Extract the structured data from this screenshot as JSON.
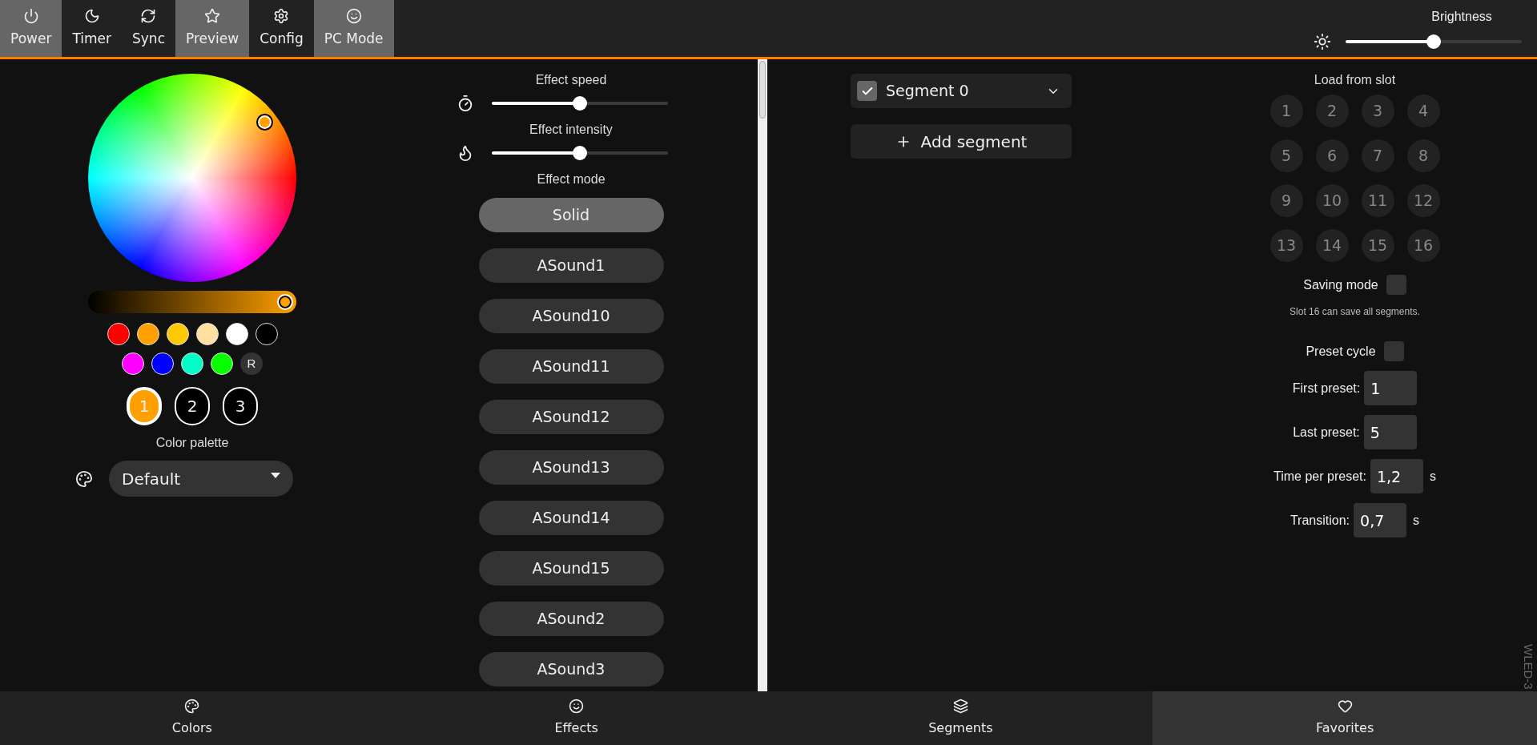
{
  "top_bar": {
    "buttons": [
      {
        "label": "Power",
        "selected": true
      },
      {
        "label": "Timer",
        "selected": false
      },
      {
        "label": "Sync",
        "selected": false
      },
      {
        "label": "Preview",
        "selected": true
      },
      {
        "label": "Config",
        "selected": false
      },
      {
        "label": "PC Mode",
        "selected": true
      }
    ],
    "brightness": {
      "label": "Brightness",
      "level": 0.5
    }
  },
  "colors": {
    "value_slider": {
      "level": 1
    },
    "quick_colors": [
      {
        "color": "#ff0000"
      },
      {
        "color": "#ffa000"
      },
      {
        "color": "#ffc800"
      },
      {
        "color": "#ffe0a0"
      },
      {
        "color": "#ffffff"
      },
      {
        "color": "#000000"
      },
      {
        "color": "#ff00ff"
      },
      {
        "color": "#0000ff"
      },
      {
        "color": "#00ffc8"
      },
      {
        "color": "#08ff00"
      }
    ],
    "random_button": "R",
    "slots": [
      {
        "label": "1",
        "selected": true
      },
      {
        "label": "2",
        "selected": false
      },
      {
        "label": "3",
        "selected": false
      }
    ],
    "palette_label": "Color palette",
    "palette": {
      "value": "Default"
    }
  },
  "effects": {
    "speed": {
      "label": "Effect speed",
      "level": 0.5
    },
    "intensity": {
      "label": "Effect intensity",
      "level": 0.5
    },
    "mode_label": "Effect mode",
    "modes": [
      {
        "label": "Solid",
        "selected": true
      },
      {
        "label": "ASound1",
        "selected": false
      },
      {
        "label": "ASound10",
        "selected": false
      },
      {
        "label": "ASound11",
        "selected": false
      },
      {
        "label": "ASound12",
        "selected": false
      },
      {
        "label": "ASound13",
        "selected": false
      },
      {
        "label": "ASound14",
        "selected": false
      },
      {
        "label": "ASound15",
        "selected": false
      },
      {
        "label": "ASound2",
        "selected": false
      },
      {
        "label": "ASound3",
        "selected": false
      }
    ]
  },
  "segments": {
    "items": [
      {
        "name": "Segment 0",
        "checked": true
      }
    ],
    "add_button": "Add segment"
  },
  "favorites": {
    "load_label": "Load from slot",
    "slots": [
      "1",
      "2",
      "3",
      "4",
      "5",
      "6",
      "7",
      "8",
      "9",
      "10",
      "11",
      "12",
      "13",
      "14",
      "15",
      "16"
    ],
    "saving_mode": {
      "label": "Saving mode",
      "checked": false
    },
    "note": "Slot 16 can save all segments.",
    "preset_cycle": {
      "label": "Preset cycle",
      "checked": false
    },
    "fields": [
      {
        "label": "First preset:",
        "value": "1"
      },
      {
        "label": "Last preset:",
        "value": "5"
      },
      {
        "label": "Time per preset:",
        "value": "1,2",
        "unit": "s"
      },
      {
        "label": "Transition:",
        "value": "0,7",
        "unit": "s"
      }
    ]
  },
  "side_label": "WLED-3",
  "bottom_tabs": [
    {
      "label": "Colors",
      "selected": false
    },
    {
      "label": "Effects",
      "selected": false
    },
    {
      "label": "Segments",
      "selected": false
    },
    {
      "label": "Favorites",
      "selected": true
    }
  ]
}
